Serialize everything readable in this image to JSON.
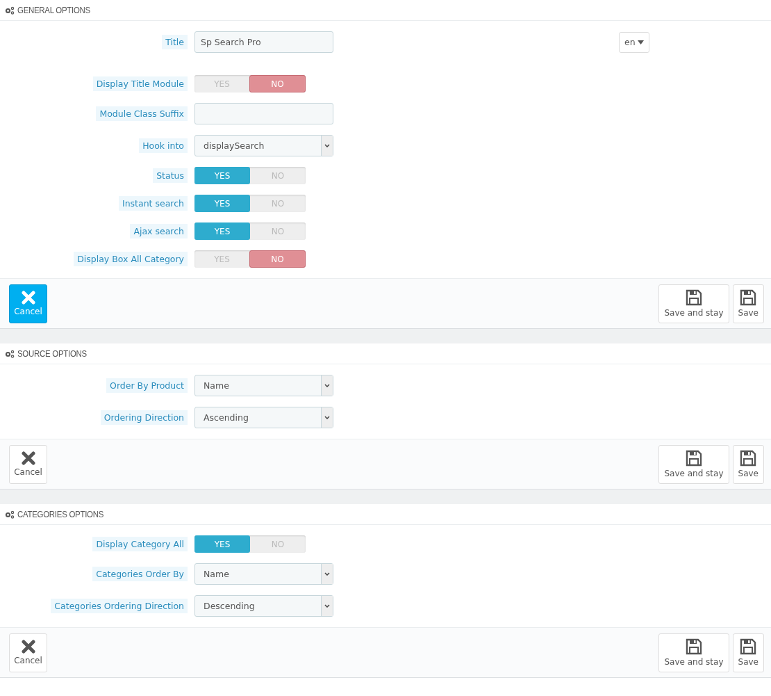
{
  "panels": [
    {
      "title": "GENERAL OPTIONS",
      "fields": [
        {
          "kind": "text",
          "label": "Title",
          "value": "Sp Search Pro",
          "language": "en"
        },
        {
          "kind": "switch",
          "label": "Display Title Module",
          "yes": "YES",
          "no": "NO",
          "on": false
        },
        {
          "kind": "text",
          "label": "Module Class Suffix"
        },
        {
          "kind": "select",
          "label": "Hook into",
          "value": "displaySearch"
        },
        {
          "kind": "switch",
          "label": "Status",
          "yes": "YES",
          "no": "NO",
          "on": true
        },
        {
          "kind": "switch",
          "label": "Instant search",
          "yes": "YES",
          "no": "NO",
          "on": true
        },
        {
          "kind": "switch",
          "label": "Ajax search",
          "yes": "YES",
          "no": "NO",
          "on": true
        },
        {
          "kind": "switch",
          "label": "Display Box All Category",
          "yes": "YES",
          "no": "NO",
          "on": false
        }
      ],
      "footer": {
        "cancel": "Cancel",
        "cancel_highlighted": true,
        "save_and_stay": "Save and stay",
        "save": "Save"
      }
    },
    {
      "title": "SOURCE OPTIONS",
      "fields": [
        {
          "kind": "select",
          "label": "Order By Product",
          "value": "Name"
        },
        {
          "kind": "select",
          "label": "Ordering Direction",
          "value": "Ascending"
        }
      ],
      "footer": {
        "cancel": "Cancel",
        "cancel_highlighted": false,
        "save_and_stay": "Save and stay",
        "save": "Save"
      }
    },
    {
      "title": "CATEGORIES OPTIONS",
      "fields": [
        {
          "kind": "switch",
          "label": "Display Category All",
          "yes": "YES",
          "no": "NO",
          "on": true
        },
        {
          "kind": "select",
          "label": "Categories Order By",
          "value": "Name"
        },
        {
          "kind": "select",
          "label": "Categories Ordering Direction",
          "value": "Descending"
        }
      ],
      "footer": {
        "cancel": "Cancel",
        "cancel_highlighted": false,
        "save_and_stay": "Save and stay",
        "save": "Save"
      }
    }
  ]
}
